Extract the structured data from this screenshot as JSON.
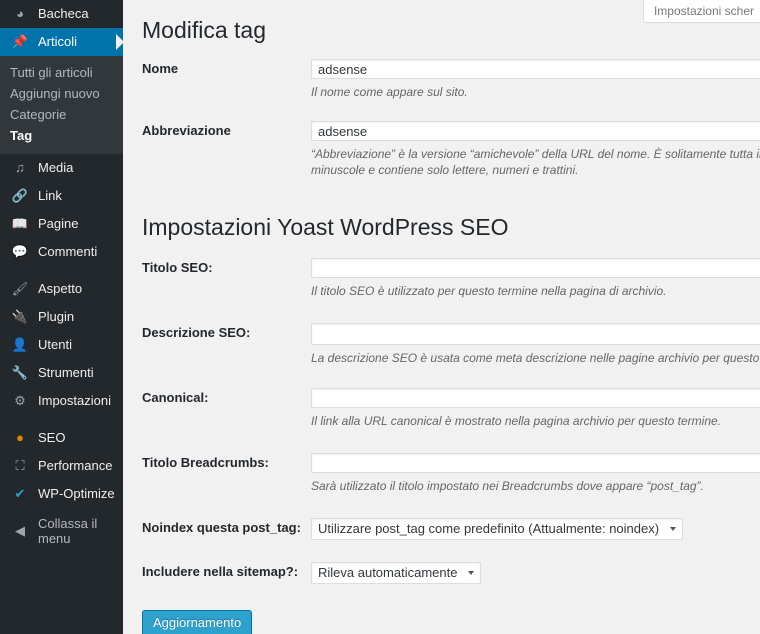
{
  "sidebar": {
    "items": [
      {
        "label": "Bacheca",
        "icon": "dashboard-icon",
        "name": "bacheca"
      },
      {
        "label": "Articoli",
        "icon": "pin-icon",
        "name": "articoli"
      },
      {
        "label": "Media",
        "icon": "media-icon",
        "name": "media"
      },
      {
        "label": "Link",
        "icon": "link-icon",
        "name": "link"
      },
      {
        "label": "Pagine",
        "icon": "pages-icon",
        "name": "pagine"
      },
      {
        "label": "Commenti",
        "icon": "comment-icon",
        "name": "commenti"
      },
      {
        "label": "Aspetto",
        "icon": "brush-icon",
        "name": "aspetto"
      },
      {
        "label": "Plugin",
        "icon": "plug-icon",
        "name": "plugin"
      },
      {
        "label": "Utenti",
        "icon": "user-icon",
        "name": "utenti"
      },
      {
        "label": "Strumenti",
        "icon": "wrench-icon",
        "name": "strumenti"
      },
      {
        "label": "Impostazioni",
        "icon": "sliders-icon",
        "name": "impostazioni"
      },
      {
        "label": "SEO",
        "icon": "yoast-icon",
        "name": "seo"
      },
      {
        "label": "Performance",
        "icon": "cube-icon",
        "name": "performance"
      },
      {
        "label": "WP-Optimize",
        "icon": "check-circle-icon",
        "name": "wp-optimize"
      }
    ],
    "submenu_articoli": [
      {
        "label": "Tutti gli articoli"
      },
      {
        "label": "Aggiungi nuovo"
      },
      {
        "label": "Categorie"
      },
      {
        "label": "Tag"
      }
    ],
    "collapse": {
      "label": "Collassa il menu",
      "icon": "collapse-icon"
    },
    "accent_current": "#0073aa",
    "background": "#23282d",
    "submenu_background": "#32373c"
  },
  "screen_meta": {
    "toggle_label": "Impostazioni scher"
  },
  "page": {
    "title": "Modifica tag",
    "section_title": "Impostazioni Yoast WordPress SEO"
  },
  "form": {
    "nome": {
      "label": "Nome",
      "value": "adsense",
      "description": "Il nome come appare sul sito."
    },
    "abbreviazione": {
      "label": "Abbreviazione",
      "value": "adsense",
      "description": "“Abbreviazione” è la versione “amichevole” della URL del nome. È solitamente tutta in minuscole e contiene solo lettere, numeri e trattini."
    },
    "titolo_seo": {
      "label": "Titolo SEO:",
      "value": "",
      "description": "Il titolo SEO è utilizzato per questo termine nella pagina di archivio."
    },
    "descrizione_seo": {
      "label": "Descrizione SEO:",
      "value": "",
      "description": "La descrizione SEO è usata come meta descrizione nelle pagine archivio per questo termine."
    },
    "canonical": {
      "label": "Canonical:",
      "value": "",
      "description": "Il link alla URL canonical è mostrato nella pagina archivio per questo termine."
    },
    "titolo_breadcrumbs": {
      "label": "Titolo Breadcrumbs:",
      "value": "",
      "description": "Sarà utilizzato il titolo impostato nei Breadcrumbs dove appare “post_tag”."
    },
    "noindex": {
      "label": "Noindex questa post_tag:",
      "selected": "Utilizzare post_tag come predefinito (Attualmente: noindex)"
    },
    "sitemap": {
      "label": "Includere nella sitemap?:",
      "selected": "Rileva automaticamente"
    },
    "submit": {
      "label": "Aggiornamento",
      "color": "#2ea2cc"
    }
  }
}
